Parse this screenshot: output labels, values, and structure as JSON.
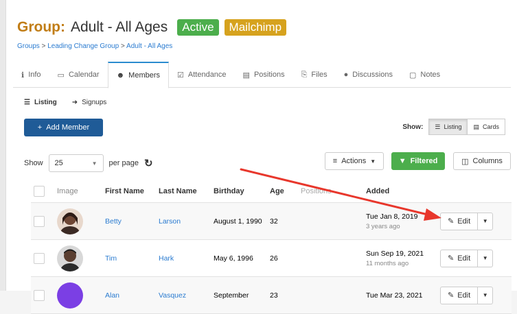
{
  "header": {
    "prefix": "Group:",
    "name": "Adult - All Ages",
    "badges": {
      "active": "Active",
      "mailchimp": "Mailchimp"
    },
    "breadcrumb": [
      "Groups",
      "Leading Change Group",
      "Adult - All Ages"
    ],
    "breadcrumb_sep": " > "
  },
  "tabs": [
    {
      "label": "Info",
      "icon": "info-circle-icon",
      "glyph": "ℹ"
    },
    {
      "label": "Calendar",
      "icon": "calendar-icon",
      "glyph": "▭"
    },
    {
      "label": "Members",
      "icon": "users-icon",
      "glyph": "👥"
    },
    {
      "label": "Attendance",
      "icon": "check-square-icon",
      "glyph": "☑"
    },
    {
      "label": "Positions",
      "icon": "id-card-icon",
      "glyph": "▤"
    },
    {
      "label": "Files",
      "icon": "files-icon",
      "glyph": "⎘"
    },
    {
      "label": "Discussions",
      "icon": "comments-icon",
      "glyph": "●"
    },
    {
      "label": "Notes",
      "icon": "note-icon",
      "glyph": "▢"
    }
  ],
  "active_tab": "Members",
  "subnav": {
    "listing": "Listing",
    "signups": "Signups"
  },
  "toolbar": {
    "add_member": "Add Member",
    "show_label": "Show:",
    "view_listing": "Listing",
    "view_cards": "Cards",
    "show": "Show",
    "per_page_value": "25",
    "per_page_label": "per page",
    "actions": "Actions",
    "filtered": "Filtered",
    "columns": "Columns"
  },
  "table": {
    "columns": [
      "Image",
      "First Name",
      "Last Name",
      "Birthday",
      "Age",
      "Positions",
      "Added"
    ],
    "rows": [
      {
        "first": "Betty",
        "last": "Larson",
        "birthday": "August 1, 1990",
        "age": "32",
        "added": "Tue Jan 8, 2019",
        "added_rel": "3 years ago",
        "edit": "Edit",
        "avatar_color": "#7a4a3a"
      },
      {
        "first": "Tim",
        "last": "Hark",
        "birthday": "May 6, 1996",
        "age": "26",
        "added": "Sun Sep 19, 2021",
        "added_rel": "11 months ago",
        "edit": "Edit",
        "avatar_color": "#5a4a3e"
      },
      {
        "first": "Alan",
        "last": "Vasquez",
        "birthday": "September",
        "age": "23",
        "added": "Tue Mar 23, 2021",
        "added_rel": "",
        "edit": "Edit",
        "avatar_color": "#7b3fe4"
      }
    ]
  },
  "colors": {
    "brand_orange": "#c17d16",
    "active_green": "#4cae4c",
    "mailchimp_gold": "#d6a21e",
    "primary_blue": "#1f5b97",
    "link_blue": "#2a7bd0",
    "annotation_arrow": "#e8372c"
  }
}
